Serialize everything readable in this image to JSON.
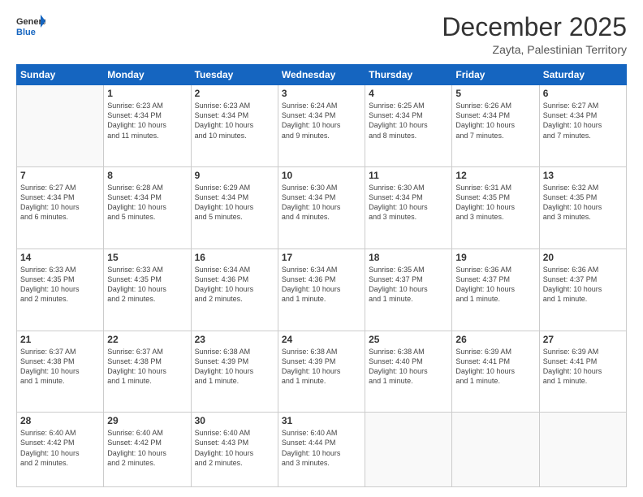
{
  "header": {
    "logo_general": "General",
    "logo_blue": "Blue",
    "month_title": "December 2025",
    "location": "Zayta, Palestinian Territory"
  },
  "days_of_week": [
    "Sunday",
    "Monday",
    "Tuesday",
    "Wednesday",
    "Thursday",
    "Friday",
    "Saturday"
  ],
  "weeks": [
    [
      {
        "day": "",
        "info": ""
      },
      {
        "day": "1",
        "info": "Sunrise: 6:23 AM\nSunset: 4:34 PM\nDaylight: 10 hours\nand 11 minutes."
      },
      {
        "day": "2",
        "info": "Sunrise: 6:23 AM\nSunset: 4:34 PM\nDaylight: 10 hours\nand 10 minutes."
      },
      {
        "day": "3",
        "info": "Sunrise: 6:24 AM\nSunset: 4:34 PM\nDaylight: 10 hours\nand 9 minutes."
      },
      {
        "day": "4",
        "info": "Sunrise: 6:25 AM\nSunset: 4:34 PM\nDaylight: 10 hours\nand 8 minutes."
      },
      {
        "day": "5",
        "info": "Sunrise: 6:26 AM\nSunset: 4:34 PM\nDaylight: 10 hours\nand 7 minutes."
      },
      {
        "day": "6",
        "info": "Sunrise: 6:27 AM\nSunset: 4:34 PM\nDaylight: 10 hours\nand 7 minutes."
      }
    ],
    [
      {
        "day": "7",
        "info": "Sunrise: 6:27 AM\nSunset: 4:34 PM\nDaylight: 10 hours\nand 6 minutes."
      },
      {
        "day": "8",
        "info": "Sunrise: 6:28 AM\nSunset: 4:34 PM\nDaylight: 10 hours\nand 5 minutes."
      },
      {
        "day": "9",
        "info": "Sunrise: 6:29 AM\nSunset: 4:34 PM\nDaylight: 10 hours\nand 5 minutes."
      },
      {
        "day": "10",
        "info": "Sunrise: 6:30 AM\nSunset: 4:34 PM\nDaylight: 10 hours\nand 4 minutes."
      },
      {
        "day": "11",
        "info": "Sunrise: 6:30 AM\nSunset: 4:34 PM\nDaylight: 10 hours\nand 3 minutes."
      },
      {
        "day": "12",
        "info": "Sunrise: 6:31 AM\nSunset: 4:35 PM\nDaylight: 10 hours\nand 3 minutes."
      },
      {
        "day": "13",
        "info": "Sunrise: 6:32 AM\nSunset: 4:35 PM\nDaylight: 10 hours\nand 3 minutes."
      }
    ],
    [
      {
        "day": "14",
        "info": "Sunrise: 6:33 AM\nSunset: 4:35 PM\nDaylight: 10 hours\nand 2 minutes."
      },
      {
        "day": "15",
        "info": "Sunrise: 6:33 AM\nSunset: 4:35 PM\nDaylight: 10 hours\nand 2 minutes."
      },
      {
        "day": "16",
        "info": "Sunrise: 6:34 AM\nSunset: 4:36 PM\nDaylight: 10 hours\nand 2 minutes."
      },
      {
        "day": "17",
        "info": "Sunrise: 6:34 AM\nSunset: 4:36 PM\nDaylight: 10 hours\nand 1 minute."
      },
      {
        "day": "18",
        "info": "Sunrise: 6:35 AM\nSunset: 4:37 PM\nDaylight: 10 hours\nand 1 minute."
      },
      {
        "day": "19",
        "info": "Sunrise: 6:36 AM\nSunset: 4:37 PM\nDaylight: 10 hours\nand 1 minute."
      },
      {
        "day": "20",
        "info": "Sunrise: 6:36 AM\nSunset: 4:37 PM\nDaylight: 10 hours\nand 1 minute."
      }
    ],
    [
      {
        "day": "21",
        "info": "Sunrise: 6:37 AM\nSunset: 4:38 PM\nDaylight: 10 hours\nand 1 minute."
      },
      {
        "day": "22",
        "info": "Sunrise: 6:37 AM\nSunset: 4:38 PM\nDaylight: 10 hours\nand 1 minute."
      },
      {
        "day": "23",
        "info": "Sunrise: 6:38 AM\nSunset: 4:39 PM\nDaylight: 10 hours\nand 1 minute."
      },
      {
        "day": "24",
        "info": "Sunrise: 6:38 AM\nSunset: 4:39 PM\nDaylight: 10 hours\nand 1 minute."
      },
      {
        "day": "25",
        "info": "Sunrise: 6:38 AM\nSunset: 4:40 PM\nDaylight: 10 hours\nand 1 minute."
      },
      {
        "day": "26",
        "info": "Sunrise: 6:39 AM\nSunset: 4:41 PM\nDaylight: 10 hours\nand 1 minute."
      },
      {
        "day": "27",
        "info": "Sunrise: 6:39 AM\nSunset: 4:41 PM\nDaylight: 10 hours\nand 1 minute."
      }
    ],
    [
      {
        "day": "28",
        "info": "Sunrise: 6:40 AM\nSunset: 4:42 PM\nDaylight: 10 hours\nand 2 minutes."
      },
      {
        "day": "29",
        "info": "Sunrise: 6:40 AM\nSunset: 4:42 PM\nDaylight: 10 hours\nand 2 minutes."
      },
      {
        "day": "30",
        "info": "Sunrise: 6:40 AM\nSunset: 4:43 PM\nDaylight: 10 hours\nand 2 minutes."
      },
      {
        "day": "31",
        "info": "Sunrise: 6:40 AM\nSunset: 4:44 PM\nDaylight: 10 hours\nand 3 minutes."
      },
      {
        "day": "",
        "info": ""
      },
      {
        "day": "",
        "info": ""
      },
      {
        "day": "",
        "info": ""
      }
    ]
  ]
}
